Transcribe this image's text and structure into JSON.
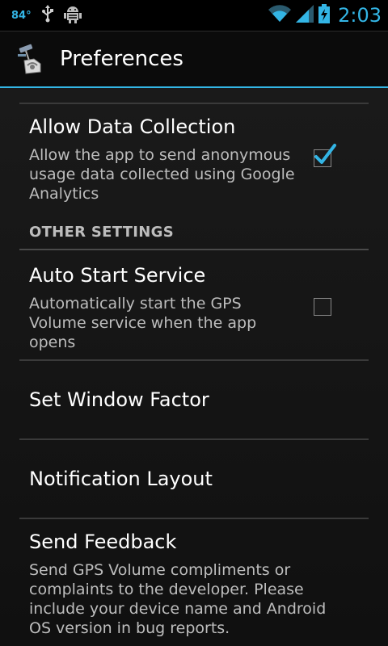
{
  "status_bar": {
    "temperature": "84°",
    "time": "2:03",
    "icons": [
      "usb-icon",
      "android-debug-icon",
      "wifi-icon",
      "signal-icon",
      "battery-charging-icon"
    ]
  },
  "action_bar": {
    "title": "Preferences",
    "icon": "app-icon"
  },
  "preferences": {
    "allow_data_collection": {
      "title": "Allow Data Collection",
      "summary": "Allow the app to send anonymous usage data collected using Google Analytics",
      "checked": true
    },
    "other_settings_header": "OTHER SETTINGS",
    "auto_start_service": {
      "title": "Auto Start Service",
      "summary": "Automatically start the GPS Volume service when the app opens",
      "checked": false
    },
    "set_window_factor": {
      "title": "Set Window Factor"
    },
    "notification_layout": {
      "title": "Notification Layout"
    },
    "send_feedback": {
      "title": "Send Feedback",
      "summary": "Send GPS Volume compliments or complaints to the developer. Please include your device name and Android OS version in bug reports."
    }
  },
  "colors": {
    "accent": "#33b5e5",
    "background": "#151515",
    "summary_text": "#bdbdbd"
  }
}
